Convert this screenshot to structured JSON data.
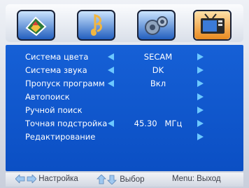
{
  "tabs": [
    {
      "icon": "picture-icon",
      "selected": false
    },
    {
      "icon": "music-note-icon",
      "selected": false
    },
    {
      "icon": "gear-icon",
      "selected": false
    },
    {
      "icon": "tv-icon",
      "selected": true
    }
  ],
  "menu": {
    "items": [
      {
        "label": "Система цвета",
        "value": "SECAM",
        "left_arrow": true,
        "right_arrow": true
      },
      {
        "label": "Система звука",
        "value": "DK",
        "left_arrow": true,
        "right_arrow": true
      },
      {
        "label": "Пропуск программ",
        "value": "Вкл",
        "left_arrow": true,
        "right_arrow": true
      },
      {
        "label": "Автопоиск",
        "value": "",
        "left_arrow": false,
        "right_arrow": true
      },
      {
        "label": "Ручной поиск",
        "value": "",
        "left_arrow": false,
        "right_arrow": true
      },
      {
        "label": "Точная подстройка",
        "value": "45.30   МГц",
        "left_arrow": true,
        "right_arrow": true
      },
      {
        "label": "Редактирование",
        "value": "",
        "left_arrow": false,
        "right_arrow": true
      }
    ]
  },
  "footer": {
    "adjust_label": "Настройка",
    "select_label": "Выбор",
    "exit_label": "Menu: Выход"
  },
  "colors": {
    "panel_blue": "#0f56cf",
    "arrow_cyan": "#6cc8ff",
    "active_tab_bg": "#f2a23c"
  }
}
